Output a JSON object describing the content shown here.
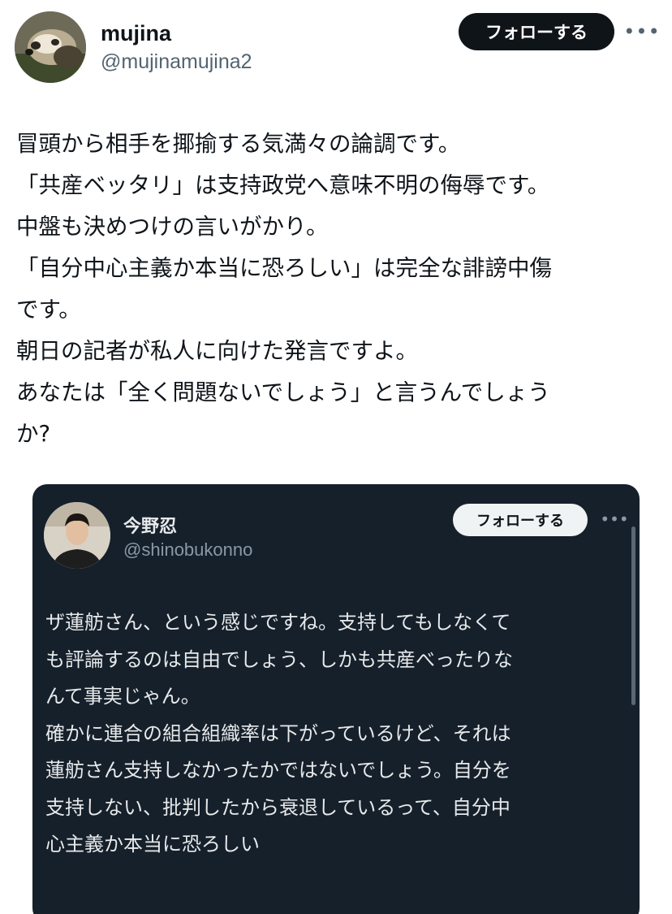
{
  "post": {
    "author_name": "mujina",
    "author_handle": "@mujinamujina2",
    "follow_label": "フォローする",
    "more_label": "•••",
    "text_lines": [
      "冒頭から相手を揶揄する気満々の論調です。",
      "「共産ベッタリ」は支持政党へ意味不明の侮辱です。",
      "中盤も決めつけの言いがかり。",
      "「自分中心主義か本当に恐ろしい」は完全な誹謗中傷",
      "です。",
      "朝日の記者が私人に向けた発言ですよ。",
      "あなたは「全く問題ないでしょう」と言うんでしょう",
      "か?"
    ]
  },
  "embedded": {
    "author_name": "今野忍",
    "author_handle": "@shinobukonno",
    "follow_label": "フォローする",
    "more_label": "•••",
    "text_lines": [
      "ザ蓮舫さん、という感じですね。支持してもしなくて",
      "も評論するのは自由でしょう、しかも共産べったりな",
      "んて事実じゃん。",
      "確かに連合の組合組織率は下がっているけど、それは",
      "蓮舫さん支持しなかったかではないでしょう。自分を",
      "支持しない、批判したから衰退しているって、自分中",
      "心主義か本当に恐ろしい"
    ]
  },
  "colors": {
    "follow_button_bg": "#0f1419",
    "embed_background": "#15202b",
    "handle_text": "#536471"
  },
  "icons": [
    "avatar-badger-icon",
    "more-options-icon"
  ]
}
